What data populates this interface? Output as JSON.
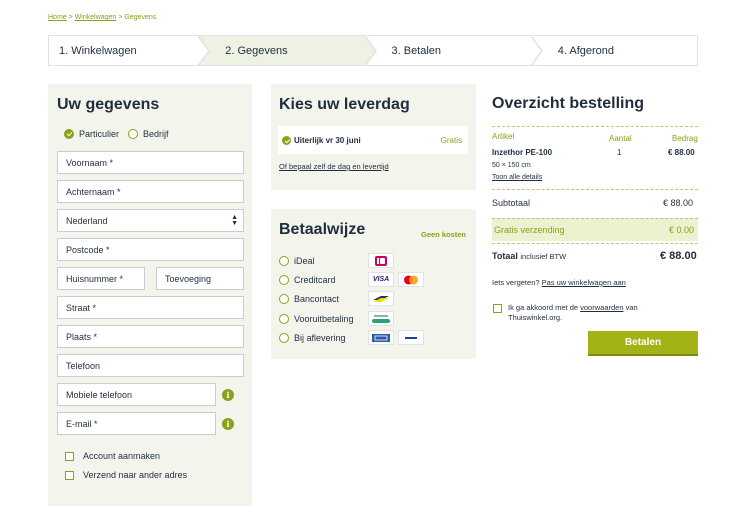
{
  "breadcrumb": {
    "home": "Home",
    "cart": "Winkelwagen",
    "current": "Gegevens",
    "sep": ">"
  },
  "steps": [
    "1. Winkelwagen",
    "2. Gegevens",
    "3. Betalen",
    "4. Afgerond"
  ],
  "details": {
    "title": "Uw gegevens",
    "type_private": "Particulier",
    "type_business": "Bedrijf",
    "fields": {
      "firstname": "Voornaam *",
      "lastname": "Achternaam *",
      "country": "Nederland",
      "postcode": "Postcode *",
      "housenumber": "Huisnummer *",
      "addition": "Toevoeging",
      "street": "Straat *",
      "city": "Plaats *",
      "phone": "Telefoon",
      "mobile": "Mobiele telefoon",
      "email": "E-mail *"
    },
    "create_account": "Account aanmaken",
    "ship_other": "Verzend naar ander adres"
  },
  "delivery": {
    "title": "Kies uw leverdag",
    "option": "Uiterlijk vr 30 juni",
    "option_price": "Gratis",
    "custom_link": "Of bepaal zelf de dag en levertijd"
  },
  "payment": {
    "title": "Betaalwijze",
    "no_costs": "Geen kosten",
    "methods": [
      "iDeal",
      "Creditcard",
      "Bancontact",
      "Vooruitbetaling",
      "Bij aflevering"
    ],
    "logos": {
      "visa": "VISA"
    }
  },
  "overview": {
    "title": "Overzicht bestelling",
    "col_article": "Artikel",
    "col_qty": "Aantal",
    "col_amount": "Bedrag",
    "product_name": "Inzethor PE-100",
    "product_qty": "1",
    "product_price": "€ 88.00",
    "product_size": "50 × 150 cm",
    "details_link": "Toon alle details",
    "subtotal_label": "Subtotaal",
    "subtotal_value": "€ 88.00",
    "shipping_label": "Gratis verzending",
    "shipping_value": "€ 0.00",
    "total_label": "Totaal",
    "total_suffix": "inclusief BTW",
    "total_value": "€ 88.00",
    "forgot_text": "Iets vergeten?",
    "forgot_link": "Pas uw winkelwagen aan",
    "agree_pre": "Ik ga akkoord met de",
    "agree_link": "voorwaarden",
    "agree_post": "van Thuiswinkel.org.",
    "pay_button": "Betalen"
  },
  "colors": {
    "accent": "#8aa11a",
    "panel": "#f3f5ec",
    "button": "#a3b214"
  }
}
